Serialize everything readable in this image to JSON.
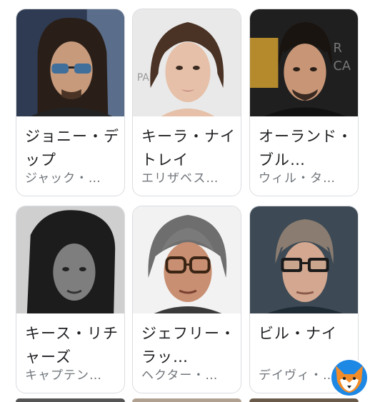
{
  "cards": [
    {
      "name": "ジョニー・デップ",
      "role": "ジャック・…"
    },
    {
      "name": "キーラ・ナイトレイ",
      "role": "エリザベス…"
    },
    {
      "name": "オーランド・ブル…",
      "role": "ウィル・タ…"
    },
    {
      "name": "キース・リチャーズ",
      "role": "キャプテン…"
    },
    {
      "name": "ジェフリー・ラッ…",
      "role": "ヘクター・…"
    },
    {
      "name": "ビル・ナイ",
      "role": "デイヴィ・…"
    }
  ],
  "icons": {
    "watermark": "fox-logo-icon"
  }
}
